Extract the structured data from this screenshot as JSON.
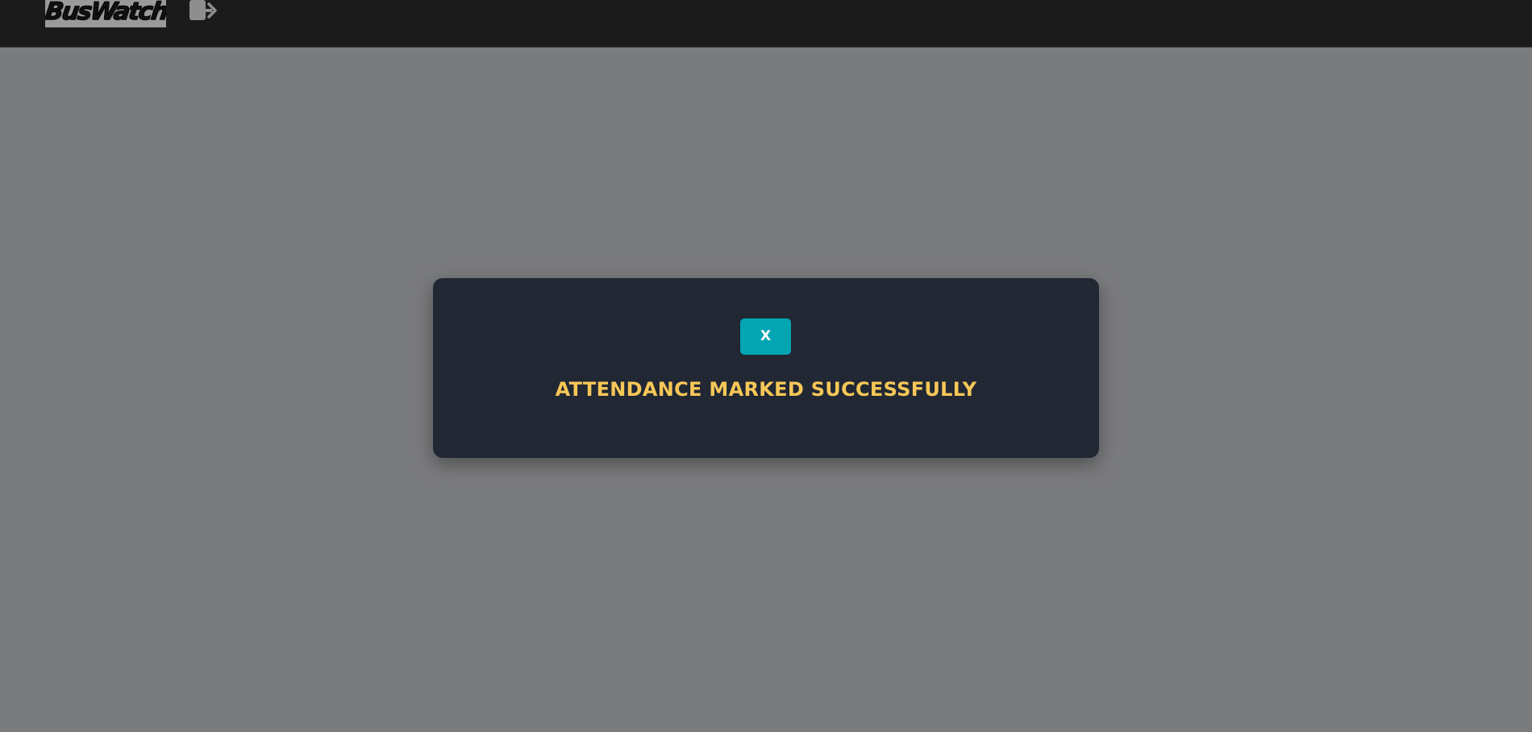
{
  "navbar": {
    "logo_text": "BusWatch",
    "logout_icon": "logout-icon"
  },
  "modal": {
    "close_label": "X",
    "message": "ATTENDANCE MARKED SUCCESSFULLY"
  },
  "colors": {
    "navbar_bg": "#1b1b1b",
    "overlay_bg": "#7a7b7d",
    "modal_bg": "#212733",
    "close_button_bg": "#04a5b3",
    "message_text": "#f7c757"
  }
}
